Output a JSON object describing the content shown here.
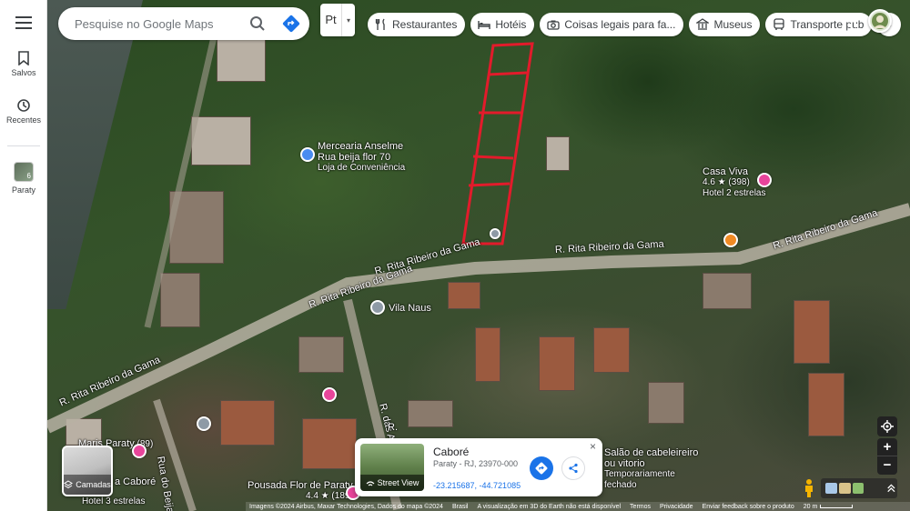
{
  "search": {
    "placeholder": "Pesquise no Google Maps"
  },
  "language_button": {
    "label": "Pt",
    "caret": "▾"
  },
  "chips": [
    {
      "label": "Restaurantes",
      "icon": "fork-knife-icon"
    },
    {
      "label": "Hotéis",
      "icon": "bed-icon"
    },
    {
      "label": "Coisas legais para fa...",
      "icon": "camera-icon"
    },
    {
      "label": "Museus",
      "icon": "museum-icon"
    },
    {
      "label": "Transporte púb",
      "icon": "bus-icon"
    }
  ],
  "chips_next": "›",
  "rail": {
    "saved_label": "Salvos",
    "recent_label": "Recentes",
    "recent_place_label": "Paraty",
    "recent_place_badge": "6"
  },
  "roads": {
    "r1": "R. Rita Ribeiro da Gama",
    "r2": "R. Rita Ribeiro da Gama",
    "r3": "R. Rita Ribeiro da Gama",
    "r4": "R. Rita Ribeiro da Gama",
    "r5": "R. Rita Ribeiro da Gama",
    "acacias": "R. das Acácias",
    "beija": "Rua do Beija",
    "r_partial": "R."
  },
  "pois": {
    "mercearia": {
      "name": "Mercearia Anselme",
      "line2": "Rua beija flor 70",
      "line3": "Loja de Conveniência"
    },
    "casa_viva": {
      "name": "Casa Viva",
      "rating": "4.6 ★ (398)",
      "category": "Hotel 2 estrelas"
    },
    "vila_naus": {
      "name": "Vila Naus"
    },
    "maris": {
      "name": "Maris Paraty",
      "rating": "(89)"
    },
    "cabore_hotel": {
      "name": "a Caboré",
      "category": "Hotel 3 estrelas"
    },
    "pousada": {
      "name": "Pousada Flor de Paraty",
      "rating": "4.4 ★ (189)"
    },
    "salao": {
      "name": "Salão de cabeleireiro",
      "line2": "ou vitorio",
      "line3": "Temporariamente",
      "line4": "fechado"
    }
  },
  "card": {
    "title": "Caboré",
    "address": "Paraty - RJ, 23970-000",
    "coords": "-23.215687, -44.721085",
    "street_view_label": "Street View",
    "close": "×"
  },
  "layers": {
    "label": "Camadas"
  },
  "zoom": {
    "in": "+",
    "out": "−"
  },
  "footer": {
    "imagery": "Imagens ©2024 Airbus, Maxar Technologies, Dados do mapa ©2024",
    "country": "Brasil",
    "notice": "A visualização em 3D do Earth não está disponível",
    "terms": "Termos",
    "privacy": "Privacidade",
    "feedback": "Enviar feedback sobre o produto",
    "scale": "20 m"
  },
  "colors": {
    "boundary": "#e21b2b",
    "accent": "#1a73e8",
    "poi_pink": "#e8459b"
  }
}
